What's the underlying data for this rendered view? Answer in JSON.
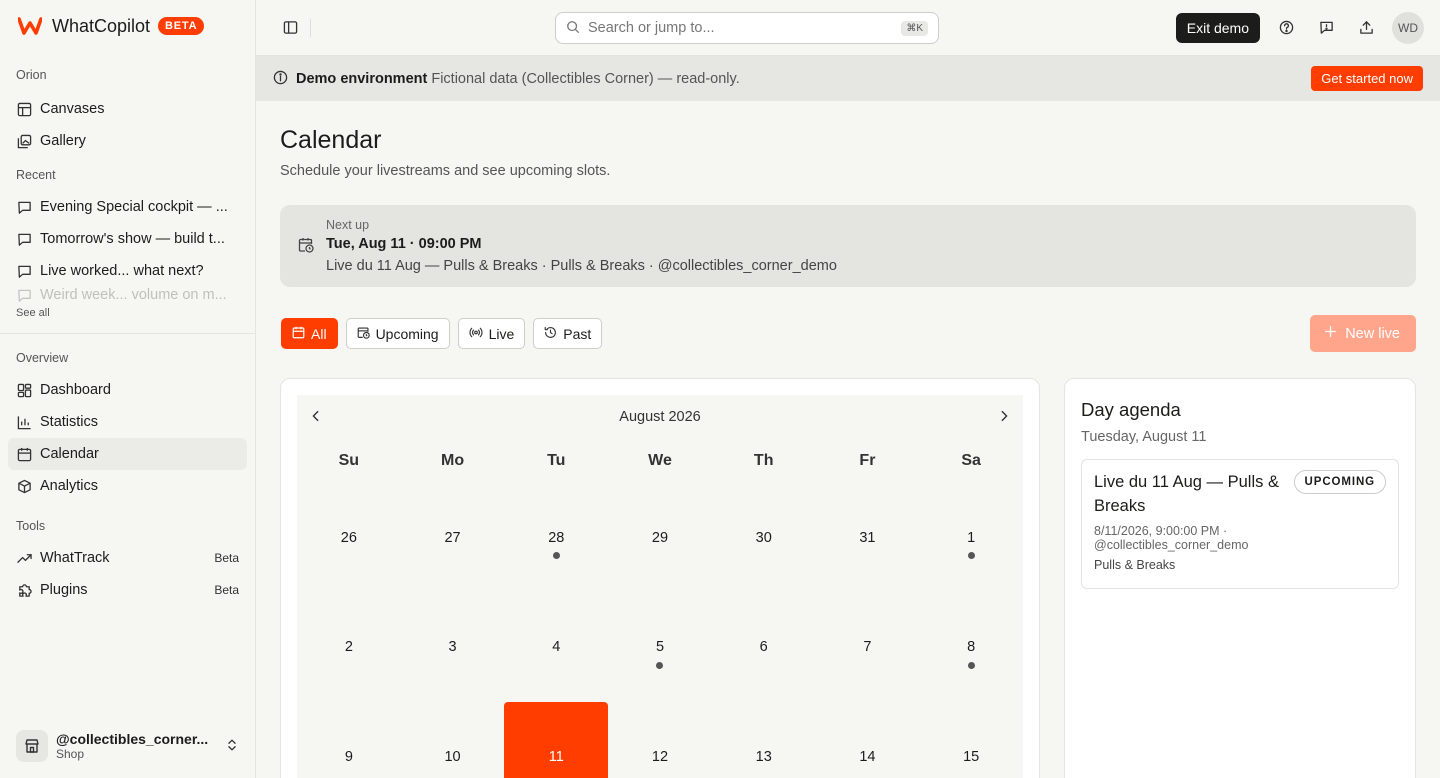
{
  "app": {
    "name": "WhatCopilot",
    "badge": "BETA"
  },
  "sidebar": {
    "workspace_label": "Orion",
    "workspace_items": [
      {
        "label": "Canvases",
        "icon": "table-icon"
      },
      {
        "label": "Gallery",
        "icon": "gallery-icon"
      }
    ],
    "recent_label": "Recent",
    "recent_items": [
      {
        "label": "Evening Special cockpit — ..."
      },
      {
        "label": "Tomorrow's show — build t..."
      },
      {
        "label": "Live worked... what next?"
      }
    ],
    "recent_faded": "Weird week... volume on m...",
    "see_all": "See all",
    "overview_label": "Overview",
    "overview_items": [
      {
        "label": "Dashboard",
        "icon": "dashboard-icon",
        "active": false
      },
      {
        "label": "Statistics",
        "icon": "bar-chart-icon",
        "active": false
      },
      {
        "label": "Calendar",
        "icon": "calendar-icon",
        "active": true
      },
      {
        "label": "Analytics",
        "icon": "cube-icon",
        "active": false
      }
    ],
    "tools_label": "Tools",
    "tools_items": [
      {
        "label": "WhatTrack",
        "badge": "Beta",
        "icon": "trend-icon"
      },
      {
        "label": "Plugins",
        "badge": "Beta",
        "icon": "puzzle-icon"
      }
    ],
    "account": {
      "name": "@collectibles_corner...",
      "sub": "Shop"
    }
  },
  "topbar": {
    "search_placeholder": "Search or jump to...",
    "search_shortcut": "⌘K",
    "exit_label": "Exit demo",
    "avatar": "WD"
  },
  "banner": {
    "title": "Demo environment",
    "text": "Fictional data (Collectibles Corner) — read-only.",
    "cta": "Get started now"
  },
  "page": {
    "title": "Calendar",
    "subtitle": "Schedule your livestreams and see upcoming slots."
  },
  "next_up": {
    "label": "Next up",
    "time": "Tue, Aug 11 · 09:00 PM",
    "desc": "Live du 11 Aug — Pulls & Breaks · Pulls & Breaks · @collectibles_corner_demo"
  },
  "filters": {
    "all": "All",
    "upcoming": "Upcoming",
    "live": "Live",
    "past": "Past",
    "new_live": "New live"
  },
  "calendar": {
    "month": "August 2026",
    "weekdays": [
      "Su",
      "Mo",
      "Tu",
      "We",
      "Th",
      "Fr",
      "Sa"
    ],
    "days": [
      {
        "n": "26",
        "dot": false,
        "sel": false
      },
      {
        "n": "27",
        "dot": false,
        "sel": false
      },
      {
        "n": "28",
        "dot": true,
        "sel": false
      },
      {
        "n": "29",
        "dot": false,
        "sel": false
      },
      {
        "n": "30",
        "dot": false,
        "sel": false
      },
      {
        "n": "31",
        "dot": false,
        "sel": false
      },
      {
        "n": "1",
        "dot": true,
        "sel": false
      },
      {
        "n": "2",
        "dot": false,
        "sel": false
      },
      {
        "n": "3",
        "dot": false,
        "sel": false
      },
      {
        "n": "4",
        "dot": false,
        "sel": false
      },
      {
        "n": "5",
        "dot": true,
        "sel": false
      },
      {
        "n": "6",
        "dot": false,
        "sel": false
      },
      {
        "n": "7",
        "dot": false,
        "sel": false
      },
      {
        "n": "8",
        "dot": true,
        "sel": false
      },
      {
        "n": "9",
        "dot": false,
        "sel": false
      },
      {
        "n": "10",
        "dot": false,
        "sel": false
      },
      {
        "n": "11",
        "dot": false,
        "sel": true
      },
      {
        "n": "12",
        "dot": false,
        "sel": false
      },
      {
        "n": "13",
        "dot": false,
        "sel": false
      },
      {
        "n": "14",
        "dot": false,
        "sel": false
      },
      {
        "n": "15",
        "dot": false,
        "sel": false
      }
    ]
  },
  "agenda": {
    "title": "Day agenda",
    "date": "Tuesday, August 11",
    "items": [
      {
        "title": "Live du 11 Aug — Pulls & Breaks",
        "status": "UPCOMING",
        "meta1": "8/11/2026, 9:00:00 PM ·",
        "meta2": "@collectibles_corner_demo",
        "category": "Pulls & Breaks"
      }
    ]
  },
  "colors": {
    "accent": "#ff3d00",
    "accent_faded": "#ffa58c",
    "dark": "#1c1c1a"
  }
}
